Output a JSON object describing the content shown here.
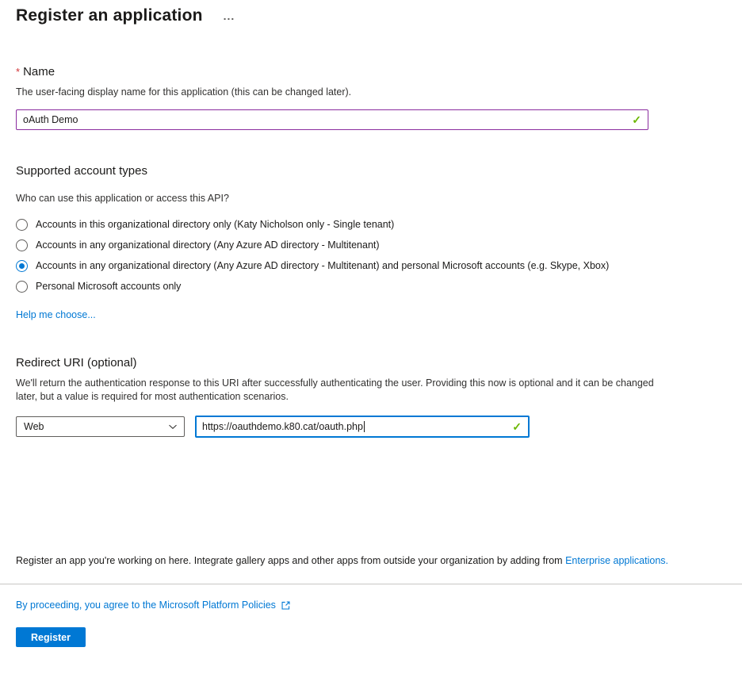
{
  "page": {
    "title": "Register an application",
    "more_options_label": "..."
  },
  "name_section": {
    "required_marker": "*",
    "label": "Name",
    "helper": "The user-facing display name for this application (this can be changed later).",
    "value": "oAuth Demo",
    "valid_check": "✓"
  },
  "account_types_section": {
    "heading": "Supported account types",
    "question": "Who can use this application or access this API?",
    "options": [
      {
        "label": "Accounts in this organizational directory only (Katy Nicholson only - Single tenant)",
        "selected": false
      },
      {
        "label": "Accounts in any organizational directory (Any Azure AD directory - Multitenant)",
        "selected": false
      },
      {
        "label": "Accounts in any organizational directory (Any Azure AD directory - Multitenant) and personal Microsoft accounts (e.g. Skype, Xbox)",
        "selected": true
      },
      {
        "label": "Personal Microsoft accounts only",
        "selected": false
      }
    ],
    "help_link": "Help me choose..."
  },
  "redirect_section": {
    "heading": "Redirect URI (optional)",
    "helper": "We'll return the authentication response to this URI after successfully authenticating the user. Providing this now is optional and it can be changed later, but a value is required for most authentication scenarios.",
    "platform_selected": "Web",
    "uri_value": "https://oauthdemo.k80.cat/oauth.php",
    "valid_check": "✓"
  },
  "footer": {
    "note_text": "Register an app you're working on here. Integrate gallery apps and other apps from outside your organization by adding from ",
    "note_link": "Enterprise applications.",
    "policy_link": "By proceeding, you agree to the Microsoft Platform Policies",
    "register_button": "Register"
  },
  "colors": {
    "accent_blue": "#0078d4",
    "valid_purple_border": "#8a2c9f",
    "success_green": "#6bb700",
    "required_red": "#d13438",
    "divider_gray": "#c8c6c4"
  }
}
